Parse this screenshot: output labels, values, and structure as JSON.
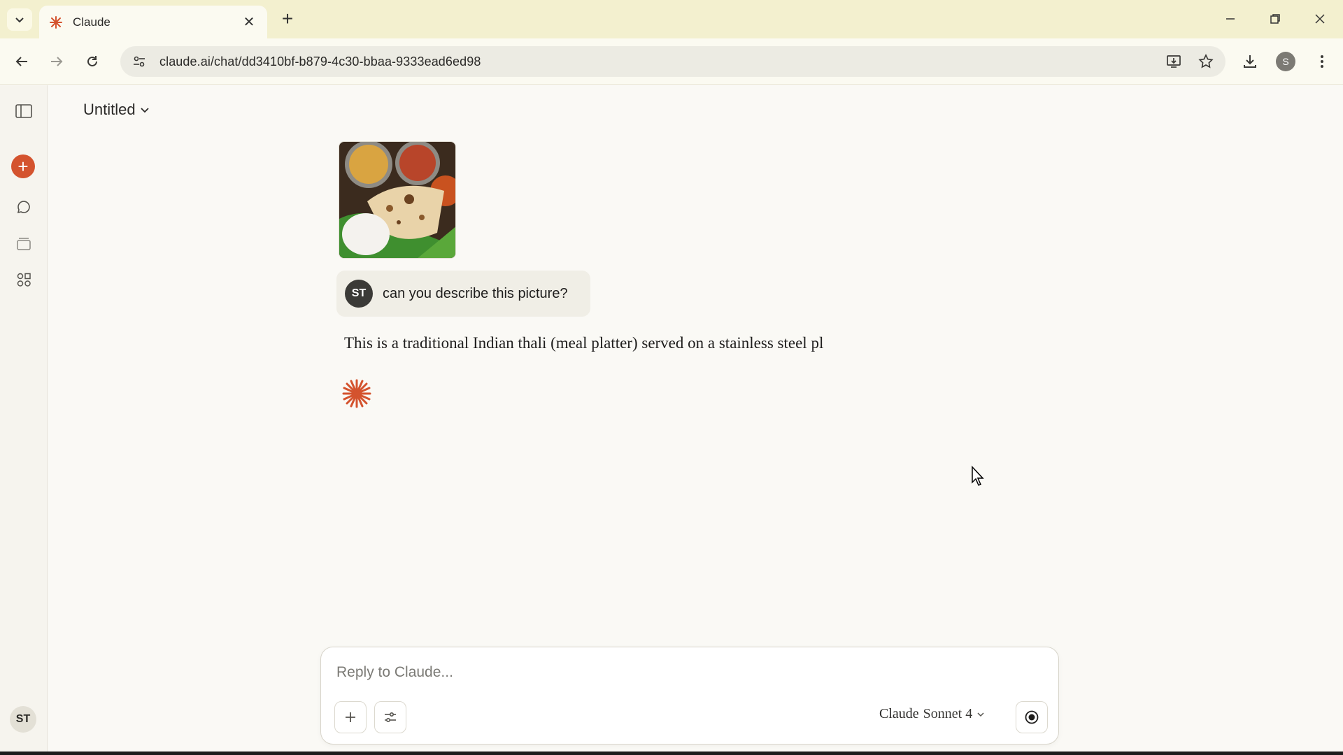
{
  "browser": {
    "tab_title": "Claude",
    "url": "claude.ai/chat/dd3410bf-b879-4c30-bbaa-9333ead6ed98",
    "profile_initial": "S"
  },
  "sidebar": {
    "user_initials": "ST"
  },
  "chat": {
    "title": "Untitled",
    "user_initials": "ST",
    "user_message": "can you describe this picture?",
    "assistant_message": "This is a traditional Indian thali (meal platter) served on a stainless steel pl"
  },
  "composer": {
    "placeholder": "Reply to Claude...",
    "model_brand": "Claude",
    "model_name": "Sonnet 4"
  },
  "colors": {
    "accent": "#d4532e",
    "tabstrip": "#f3f0cf",
    "background": "#faf9f5"
  }
}
